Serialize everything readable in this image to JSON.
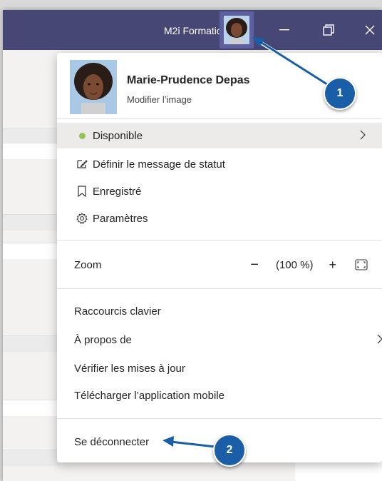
{
  "titlebar": {
    "org_name": "M2i Formation",
    "chevron_icon": "chevron-down-icon",
    "controls": [
      "minimize-icon",
      "maximize-icon",
      "close-icon"
    ],
    "color": "#464775"
  },
  "profile": {
    "name": "Marie-Prudence Depas",
    "change_picture": "Modifier l’image"
  },
  "menu": {
    "status": {
      "label": "Disponible",
      "color": "#92c353"
    },
    "set_status_message": "Définir le message de statut",
    "saved": "Enregistré",
    "settings": "Paramètres",
    "zoom": {
      "label": "Zoom",
      "minus": "−",
      "value": "(100 %)",
      "plus": "+"
    },
    "keyboard_shortcuts": "Raccourcis clavier",
    "about": "À propos de",
    "check_updates": "Vérifier les mises à jour",
    "download_mobile": "Télécharger l’application mobile",
    "sign_out": "Se déconnecter"
  },
  "callouts": [
    "1",
    "2"
  ],
  "callout_color": "#1a5ea8"
}
